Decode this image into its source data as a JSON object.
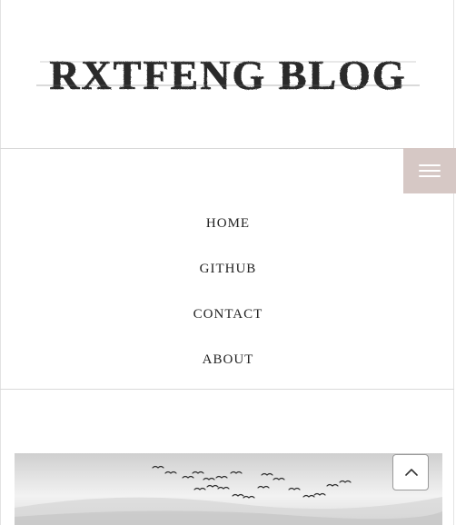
{
  "site": {
    "logo_text": "RXTFENG BLOG"
  },
  "header": {
    "menu_toggle_icon": "hamburger-menu-icon"
  },
  "nav": {
    "items": [
      {
        "label": "HOME"
      },
      {
        "label": "GITHUB"
      },
      {
        "label": "CONTACT"
      },
      {
        "label": "ABOUT"
      }
    ]
  },
  "hero": {
    "image": "grayscale-sky-with-flock-of-birds"
  },
  "back_to_top": {
    "icon": "chevron-up-icon"
  },
  "colors": {
    "menu_toggle_bg": "#d6c8c5",
    "text": "#222222",
    "divider": "#d9d9d9"
  }
}
